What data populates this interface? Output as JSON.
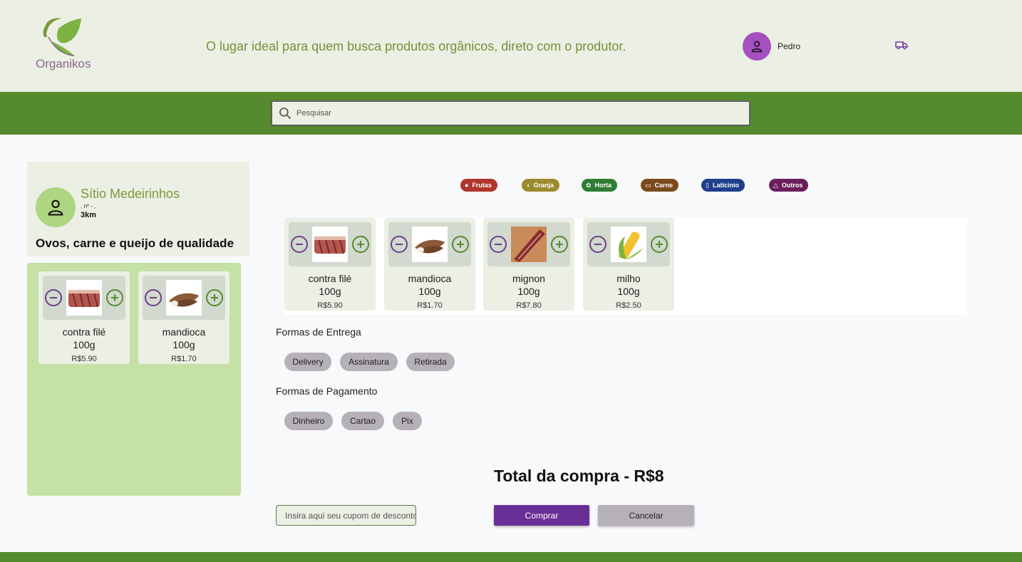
{
  "header": {
    "logo_text": "Organikos",
    "tagline": "O lugar ideal para quem busca produtos orgânicos, direto com o produtor.",
    "user_name": "Pedro",
    "user_icon": "person-icon",
    "cart_icon": "truck-icon"
  },
  "search": {
    "placeholder": "Pesquisar"
  },
  "farm": {
    "name": "Sítio Medeirinhos",
    "address": ", nº - ,",
    "distance": "3km",
    "description": "Ovos, carne e queijo de qualidade",
    "products": [
      {
        "name": "contra filé",
        "qty": "100g",
        "price": "R$5.90"
      },
      {
        "name": "mandioca",
        "qty": "100g",
        "price": "R$1.70"
      }
    ]
  },
  "categories": [
    {
      "label": "Frutas",
      "color": "#b0352c",
      "icon": "apple-icon"
    },
    {
      "label": "Granja",
      "color": "#9c8a2c",
      "icon": "chicken-icon"
    },
    {
      "label": "Horta",
      "color": "#2e7d32",
      "icon": "leaf-icon"
    },
    {
      "label": "Carne",
      "color": "#7a4a1c",
      "icon": "meat-icon"
    },
    {
      "label": "Laticínio",
      "color": "#1f3f8c",
      "icon": "milk-icon"
    },
    {
      "label": "Outros",
      "color": "#6a1f5c",
      "icon": "shapes-icon"
    }
  ],
  "products": [
    {
      "name": "contra filé",
      "qty": "100g",
      "price": "R$5.90"
    },
    {
      "name": "mandioca",
      "qty": "100g",
      "price": "R$1.70"
    },
    {
      "name": "mignon",
      "qty": "100g",
      "price": "R$7.80"
    },
    {
      "name": "milho",
      "qty": "100g",
      "price": "R$2.50"
    }
  ],
  "delivery": {
    "title": "Formas de Entrega",
    "options": [
      "Delivery",
      "Assinatura",
      "Retirada"
    ]
  },
  "payment": {
    "title": "Formas de Pagamento",
    "options": [
      "Dinheiro",
      "Cartao",
      "Pix"
    ]
  },
  "checkout": {
    "total": "Total da compra - R$8",
    "coupon_placeholder": "Insira aqui seu cupom de desconto",
    "buy_label": "Comprar",
    "cancel_label": "Cancelar"
  }
}
